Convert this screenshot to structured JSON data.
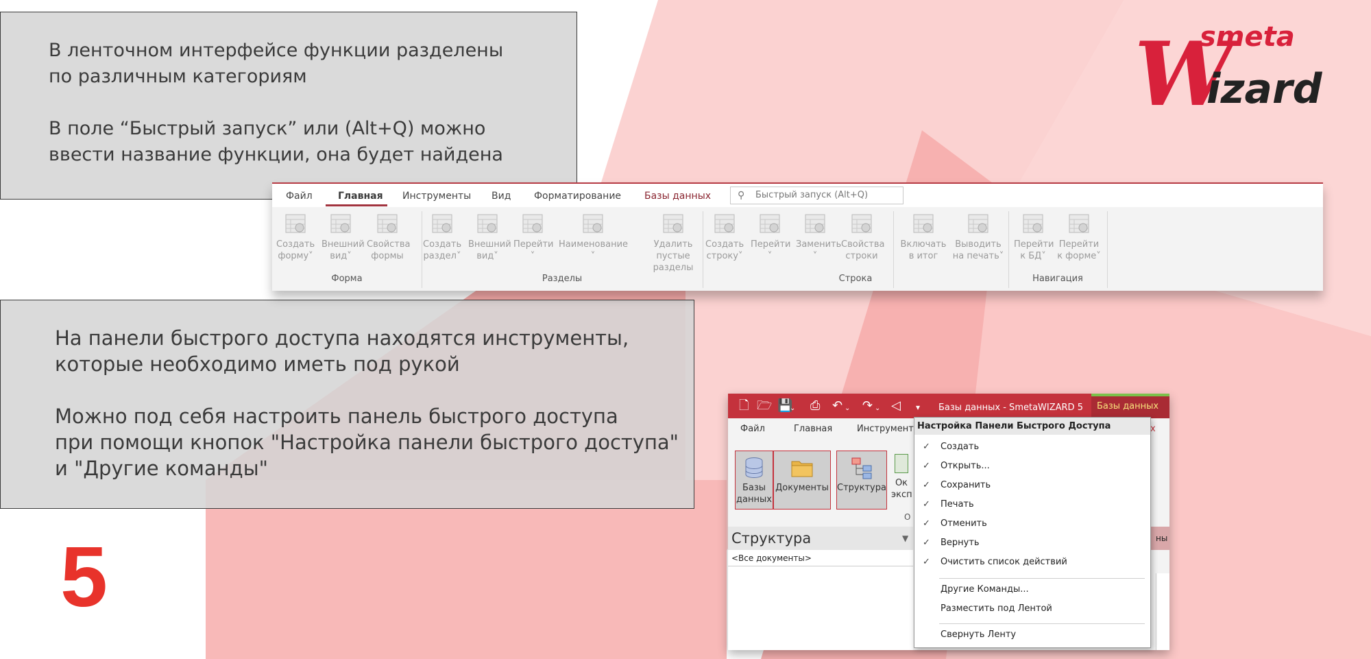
{
  "colors": {
    "accent": "#c4323c",
    "highlight_number": "#e8332b",
    "box_bg": "#d5d5d5",
    "triangle": "#f6aaa9"
  },
  "logo": {
    "line1": "smeta",
    "line2": "Wizard"
  },
  "box1": {
    "lines": [
      "В ленточном интерфейсе функции разделены",
      "по различным категориям",
      "",
      "В поле “Быстрый запуск” или (Alt+Q) можно",
      "ввести название функции, она будет найдена"
    ]
  },
  "box2": {
    "lines": [
      "На панели быстрого доступа находятся инструменты,",
      "которые необходимо иметь под рукой",
      "",
      "Можно под себя настроить панель быстрого доступа",
      "при помощи кнопок \"Настройка панели быстрого доступа\"",
      "и \"Другие команды\""
    ]
  },
  "page_number": "5",
  "ribbon": {
    "tabs": [
      "Файл",
      "Главная",
      "Инструменты",
      "Вид",
      "Форматирование",
      "Базы данных"
    ],
    "active_tab": "Главная",
    "quick_launch_placeholder": "Быстрый запуск (Alt+Q)",
    "buttons": [
      {
        "label": "Создать\nформу˅",
        "icon": "create-form-icon"
      },
      {
        "label": "Внешний\nвид˅",
        "icon": "appearance-icon"
      },
      {
        "label": "Свойства\nформы",
        "icon": "form-properties-icon"
      },
      {
        "label": "Создать\nраздел˅",
        "icon": "create-section-icon"
      },
      {
        "label": "Внешний\nвид˅",
        "icon": "appearance-icon"
      },
      {
        "label": "Перейти\n˅",
        "icon": "goto-icon"
      },
      {
        "label": "Наименование\n˅",
        "icon": "naming-icon"
      },
      {
        "label": "Удалить пустые\nразделы",
        "icon": "delete-empty-icon"
      },
      {
        "label": "Создать\nстроку˅",
        "icon": "create-row-icon"
      },
      {
        "label": "Перейти\n˅",
        "icon": "goto-icon"
      },
      {
        "label": "Заменить\n˅",
        "icon": "replace-icon"
      },
      {
        "label": "Свойства\nстроки",
        "icon": "row-properties-icon"
      },
      {
        "label": "Включать\nв итог",
        "icon": "include-total-icon"
      },
      {
        "label": "Выводить\nна печать˅",
        "icon": "print-output-icon"
      },
      {
        "label": "Перейти\nк БД˅",
        "icon": "goto-db-icon"
      },
      {
        "label": "Перейти\nк форме˅",
        "icon": "goto-form-icon"
      }
    ],
    "groups": [
      "Форма",
      "Разделы",
      "Строка",
      "Навигация"
    ]
  },
  "access": {
    "title": "Базы данных - SmetaWIZARD 5",
    "context_tab": "Базы данных",
    "tabs": [
      "Файл",
      "Главная",
      "Инструмент"
    ],
    "qat_icons": [
      "new-document-icon",
      "open-folder-icon",
      "save-icon",
      "print-icon",
      "undo-icon",
      "redo-icon",
      "clear-icon",
      "customize-qat-icon"
    ],
    "big_buttons": [
      {
        "label": "Базы\nданных",
        "icon": "database-icon"
      },
      {
        "label": "Документы",
        "icon": "folder-icon"
      },
      {
        "label": "Структура",
        "icon": "structure-icon"
      }
    ],
    "partial_button": "Ок\nэкспе",
    "partial_group": "О",
    "structure_title": "Структура",
    "structure_filter": "<Все документы>",
    "right_strip_text": "ны",
    "right_tab_fragment": "х"
  },
  "qat_menu": {
    "header": "Настройка Панели Быстрого Доступа",
    "checked_items": [
      "Создать",
      "Открыть...",
      "Сохранить",
      "Печать",
      "Отменить",
      "Вернуть",
      "Очистить список действий"
    ],
    "other_items": [
      "Другие Команды...",
      "Разместить под Лентой"
    ],
    "bottom_item": "Свернуть Ленту"
  }
}
